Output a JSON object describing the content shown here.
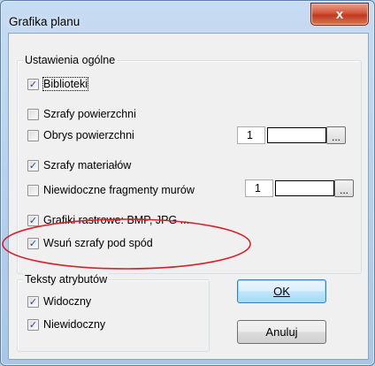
{
  "window": {
    "title": "Grafika planu",
    "close_glyph": "x"
  },
  "general_group": {
    "label": "Ustawienia ogólne",
    "items": [
      {
        "label": "Biblioteki",
        "checked": true
      },
      {
        "label": "Szrafy powierzchni",
        "checked": false
      },
      {
        "label": "Obrys powierzchni",
        "checked": false
      },
      {
        "label": "Szrafy materiałów",
        "checked": true
      },
      {
        "label": "Niewidoczne fragmenty murów",
        "checked": false
      },
      {
        "label": "Grafiki rastrowe: BMP, JPG ...",
        "checked": true
      },
      {
        "label": "Wsuń szrafy pod spód",
        "checked": true
      }
    ],
    "obrys_value": "1",
    "mury_value": "1",
    "browse_label": "..."
  },
  "attributes_group": {
    "label": "Teksty atrybutów",
    "items": [
      {
        "label": "Widoczny",
        "checked": true
      },
      {
        "label": "Niewidoczny",
        "checked": true
      }
    ]
  },
  "buttons": {
    "ok": "OK",
    "cancel": "Anuluj"
  },
  "colors": {
    "annotation": "#d9202a",
    "title_bar": "#b9d1ea",
    "dialog_face": "#f0f0f0"
  },
  "icons": {
    "checkmark": "✓",
    "close": "close-icon"
  }
}
